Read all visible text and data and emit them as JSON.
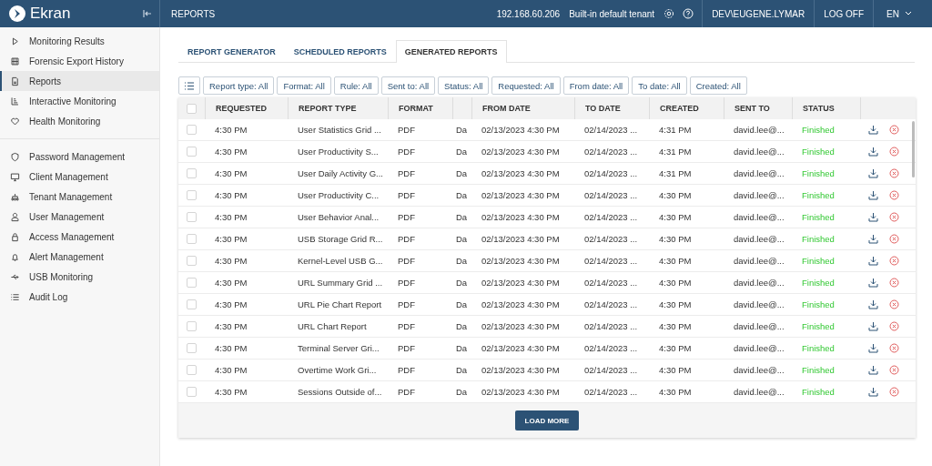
{
  "header": {
    "logo": "Ekran",
    "page_title": "REPORTS",
    "ip": "192.168.60.206",
    "tenant": "Built-in default tenant",
    "user": "DEV\\EUGENE.LYMAR",
    "logoff": "LOG OFF",
    "language": "EN"
  },
  "sidebar": {
    "groups": [
      [
        {
          "label": "Monitoring Results",
          "selected": false
        },
        {
          "label": "Forensic Export History",
          "selected": false
        },
        {
          "label": "Reports",
          "selected": true
        },
        {
          "label": "Interactive Monitoring",
          "selected": false
        },
        {
          "label": "Health Monitoring",
          "selected": false
        }
      ],
      [
        {
          "label": "Password Management",
          "selected": false
        },
        {
          "label": "Client Management",
          "selected": false
        },
        {
          "label": "Tenant Management",
          "selected": false
        },
        {
          "label": "User Management",
          "selected": false
        },
        {
          "label": "Access Management",
          "selected": false
        },
        {
          "label": "Alert Management",
          "selected": false
        },
        {
          "label": "USB Monitoring",
          "selected": false
        },
        {
          "label": "Audit Log",
          "selected": false
        }
      ]
    ]
  },
  "tabs": [
    {
      "label": "REPORT GENERATOR",
      "selected": false
    },
    {
      "label": "SCHEDULED REPORTS",
      "selected": false
    },
    {
      "label": "GENERATED REPORTS",
      "selected": true
    }
  ],
  "filters": [
    "Report type: All",
    "Format: All",
    "Rule: All",
    "Sent to: All",
    "Status: All",
    "Requested: All",
    "From date: All",
    "To date: All",
    "Created: All"
  ],
  "table": {
    "columns": [
      "REQUESTED",
      "REPORT TYPE",
      "FORMAT",
      "",
      "FROM DATE",
      "TO DATE",
      "CREATED",
      "SENT TO",
      "STATUS"
    ],
    "all_checked": false,
    "rows": [
      {
        "checked": false,
        "requested": "4:30 PM",
        "report_type": "User Statistics Grid ...",
        "format": "PDF",
        "column_5": "Da",
        "from_date": "02/13/2023 4:30 PM",
        "to_date": "02/14/2023 ...",
        "created": "4:31 PM",
        "sent_to": "david.lee@...",
        "status": "Finished"
      },
      {
        "checked": false,
        "requested": "4:30 PM",
        "report_type": "User Productivity S...",
        "format": "PDF",
        "column_5": "Da",
        "from_date": "02/13/2023 4:30 PM",
        "to_date": "02/14/2023 ...",
        "created": "4:31 PM",
        "sent_to": "david.lee@...",
        "status": "Finished"
      },
      {
        "checked": false,
        "requested": "4:30 PM",
        "report_type": "User Daily Activity G...",
        "format": "PDF",
        "column_5": "Da",
        "from_date": "02/13/2023 4:30 PM",
        "to_date": "02/14/2023 ...",
        "created": "4:31 PM",
        "sent_to": "david.lee@...",
        "status": "Finished"
      },
      {
        "checked": false,
        "requested": "4:30 PM",
        "report_type": "User Productivity C...",
        "format": "PDF",
        "column_5": "Da",
        "from_date": "02/13/2023 4:30 PM",
        "to_date": "02/14/2023 ...",
        "created": "4:30 PM",
        "sent_to": "david.lee@...",
        "status": "Finished"
      },
      {
        "checked": false,
        "requested": "4:30 PM",
        "report_type": "User Behavior Anal...",
        "format": "PDF",
        "column_5": "Da",
        "from_date": "02/13/2023 4:30 PM",
        "to_date": "02/14/2023 ...",
        "created": "4:30 PM",
        "sent_to": "david.lee@...",
        "status": "Finished"
      },
      {
        "checked": false,
        "requested": "4:30 PM",
        "report_type": "USB Storage Grid R...",
        "format": "PDF",
        "column_5": "Da",
        "from_date": "02/13/2023 4:30 PM",
        "to_date": "02/14/2023 ...",
        "created": "4:30 PM",
        "sent_to": "david.lee@...",
        "status": "Finished"
      },
      {
        "checked": false,
        "requested": "4:30 PM",
        "report_type": "Kernel-Level USB G...",
        "format": "PDF",
        "column_5": "Da",
        "from_date": "02/13/2023 4:30 PM",
        "to_date": "02/14/2023 ...",
        "created": "4:30 PM",
        "sent_to": "david.lee@...",
        "status": "Finished"
      },
      {
        "checked": false,
        "requested": "4:30 PM",
        "report_type": "URL Summary Grid ...",
        "format": "PDF",
        "column_5": "Da",
        "from_date": "02/13/2023 4:30 PM",
        "to_date": "02/14/2023 ...",
        "created": "4:30 PM",
        "sent_to": "david.lee@...",
        "status": "Finished"
      },
      {
        "checked": false,
        "requested": "4:30 PM",
        "report_type": "URL Pie Chart Report",
        "format": "PDF",
        "column_5": "Da",
        "from_date": "02/13/2023 4:30 PM",
        "to_date": "02/14/2023 ...",
        "created": "4:30 PM",
        "sent_to": "david.lee@...",
        "status": "Finished"
      },
      {
        "checked": false,
        "requested": "4:30 PM",
        "report_type": "URL Chart Report",
        "format": "PDF",
        "column_5": "Da",
        "from_date": "02/13/2023 4:30 PM",
        "to_date": "02/14/2023 ...",
        "created": "4:30 PM",
        "sent_to": "david.lee@...",
        "status": "Finished"
      },
      {
        "checked": false,
        "requested": "4:30 PM",
        "report_type": "Terminal Server Gri...",
        "format": "PDF",
        "column_5": "Da",
        "from_date": "02/13/2023 4:30 PM",
        "to_date": "02/14/2023 ...",
        "created": "4:30 PM",
        "sent_to": "david.lee@...",
        "status": "Finished"
      },
      {
        "checked": false,
        "requested": "4:30 PM",
        "report_type": "Overtime Work Gri...",
        "format": "PDF",
        "column_5": "Da",
        "from_date": "02/13/2023 4:30 PM",
        "to_date": "02/14/2023 ...",
        "created": "4:30 PM",
        "sent_to": "david.lee@...",
        "status": "Finished"
      },
      {
        "checked": false,
        "requested": "4:30 PM",
        "report_type": "Sessions Outside of...",
        "format": "PDF",
        "column_5": "Da",
        "from_date": "02/13/2023 4:30 PM",
        "to_date": "02/14/2023 ...",
        "created": "4:30 PM",
        "sent_to": "david.lee@...",
        "status": "Finished"
      }
    ]
  },
  "load_more": "LOAD MORE"
}
